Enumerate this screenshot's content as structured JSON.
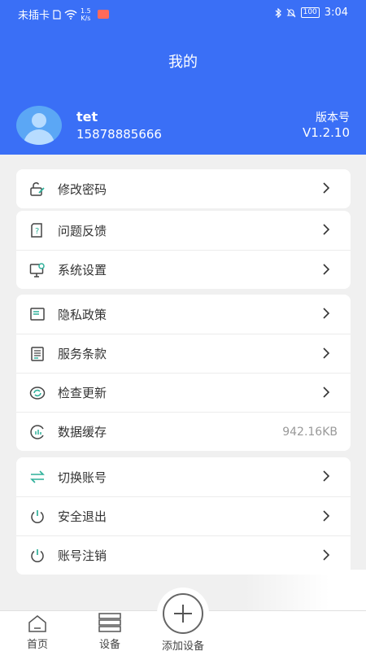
{
  "status_bar": {
    "carrier": "未插卡",
    "speed_top": "1.5",
    "speed_bottom": "K/s",
    "battery": "100",
    "time": "3:04"
  },
  "page": {
    "title": "我的"
  },
  "user": {
    "name": "tet",
    "phone": "15878885666"
  },
  "version": {
    "label": "版本号",
    "value": "V1.2.10"
  },
  "menu": {
    "change_password": "修改密码",
    "feedback": "问题反馈",
    "system_settings": "系统设置",
    "privacy_policy": "隐私政策",
    "terms": "服务条款",
    "check_update": "检查更新",
    "data_cache": "数据缓存",
    "data_cache_value": "942.16KB",
    "switch_account": "切换账号",
    "logout": "安全退出",
    "cancel_account": "账号注销"
  },
  "tabbar": {
    "home": "首页",
    "devices": "设备",
    "add_device": "添加设备"
  },
  "colors": {
    "header": "#3a6ff6",
    "accent_icon": "#2eb09a"
  }
}
